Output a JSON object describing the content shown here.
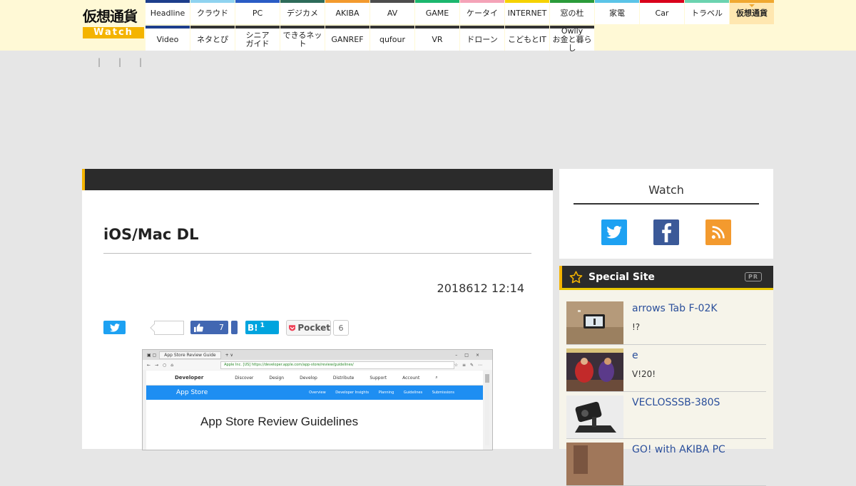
{
  "logo": {
    "top": "仮想通貨",
    "bottom": "Watch"
  },
  "nav": {
    "row1": [
      {
        "label": "Headline",
        "color": "#1d3e8c"
      },
      {
        "label": "クラウド",
        "color": "#8fd3f0"
      },
      {
        "label": "PC",
        "color": "#2a5cc5"
      },
      {
        "label": "デジカメ",
        "color": "#2e6b5a"
      },
      {
        "label": "AKIBA",
        "color": "#f39a2e"
      },
      {
        "label": "AV",
        "color": "#4d4d4d"
      },
      {
        "label": "GAME",
        "color": "#1bb76e"
      },
      {
        "label": "ケータイ",
        "color": "#f4a3b8"
      },
      {
        "label": "INTERNET",
        "color": "#f6d200"
      },
      {
        "label": "窓の杜",
        "color": "#2b9b3a"
      },
      {
        "label": "家電",
        "color": "#5bc4e8"
      },
      {
        "label": "Car",
        "color": "#d9001b"
      },
      {
        "label": "トラベル",
        "color": "#6bd3b0"
      },
      {
        "label": "仮想通貨",
        "color": "#f0a830",
        "active": true
      }
    ],
    "row2": [
      {
        "label": "Video",
        "color": "#1d3e8c"
      },
      {
        "label": "ネタとぴ",
        "color": "#333333"
      },
      {
        "label": "シニア\nガイド",
        "color": "#333333"
      },
      {
        "label": "できるネット",
        "color": "#333333"
      },
      {
        "label": "GANREF",
        "color": "#333333"
      },
      {
        "label": "qufour",
        "color": "#333333"
      },
      {
        "label": "VR",
        "color": "#333333"
      },
      {
        "label": "ドローン",
        "color": "#333333"
      },
      {
        "label": "こどもとIT",
        "color": "#333333"
      },
      {
        "label": "Owlly\nお金と暮らし",
        "color": "#333333"
      }
    ]
  },
  "breadcrumb_separators": [
    "|",
    "|",
    "|"
  ],
  "article": {
    "title": "iOS/Mac DL",
    "date": "2018612 12:14",
    "share": {
      "facebook_count": "7",
      "hatena_label": "B!",
      "hatena_count": "1",
      "pocket_label": "Pocket",
      "pocket_count": "6"
    },
    "screenshot": {
      "tab_label": "App Store Review Guide",
      "url": "Apple Inc. [US] https://developer.apple.com/app-store/review/guidelines/",
      "dev_label": "Developer",
      "dev_nav": [
        "Discover",
        "Design",
        "Develop",
        "Distribute",
        "Support",
        "Account"
      ],
      "banner_title": "App Store",
      "banner_links": [
        "Overview",
        "Developer Insights",
        "Planning",
        "Guidelines",
        "Submissions"
      ],
      "heading": "App Store Review Guidelines"
    }
  },
  "sidebar": {
    "watch_title": "Watch",
    "special_title": "Special Site",
    "pr_label": "PR",
    "items": [
      {
        "title": "arrows Tab F-02K",
        "sub": "!?"
      },
      {
        "title": "e",
        "sub": "V!20!"
      },
      {
        "title": "VECLOSSSB-380S",
        "sub": ""
      },
      {
        "title": "GO! with AKIBA PC",
        "sub": ""
      }
    ]
  },
  "colors": {
    "accent": "#f4b400",
    "header_bg": "#fff9d6",
    "dark_bar": "#2b2b2b",
    "link": "#2b4f9b"
  }
}
